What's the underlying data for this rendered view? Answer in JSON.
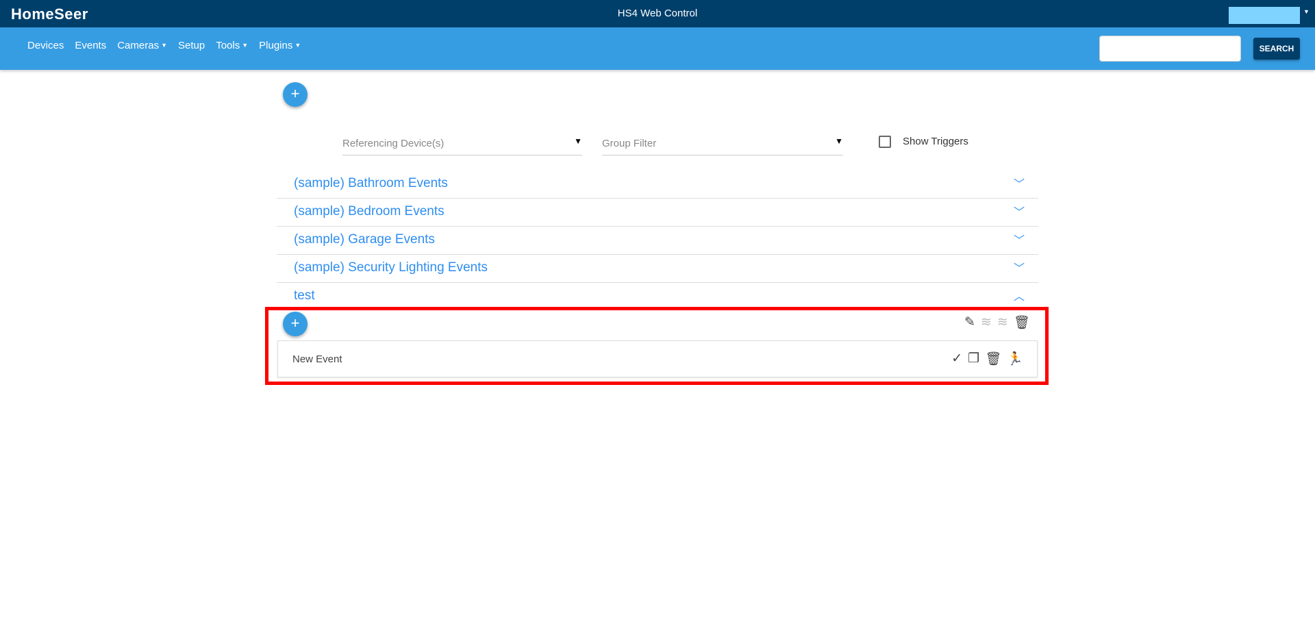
{
  "header": {
    "logo": "HomeSeer",
    "title": "HS4 Web Control"
  },
  "nav": {
    "items": [
      {
        "label": "Devices"
      },
      {
        "label": "Events"
      },
      {
        "label": "Cameras",
        "dropdown": true
      },
      {
        "label": "Setup"
      },
      {
        "label": "Tools",
        "dropdown": true
      },
      {
        "label": "Plugins",
        "dropdown": true
      }
    ],
    "search_label": "SEARCH",
    "search_value": ""
  },
  "filters": {
    "referencing": "Referencing Device(s)",
    "group": "Group Filter",
    "show_triggers": "Show Triggers",
    "show_triggers_checked": false
  },
  "add_icon": "+",
  "groups": [
    {
      "label": "(sample) Bathroom Events",
      "expanded": false
    },
    {
      "label": "(sample) Bedroom Events",
      "expanded": false
    },
    {
      "label": "(sample) Garage Events",
      "expanded": false
    },
    {
      "label": "(sample) Security Lighting Events",
      "expanded": false
    },
    {
      "label": "test",
      "expanded": true
    }
  ],
  "events": [
    {
      "name": "New Event"
    }
  ],
  "colors": {
    "topbar": "#013f6b",
    "navbar": "#369de3",
    "link": "#2f8ef0",
    "highlight": "#ff0000"
  }
}
